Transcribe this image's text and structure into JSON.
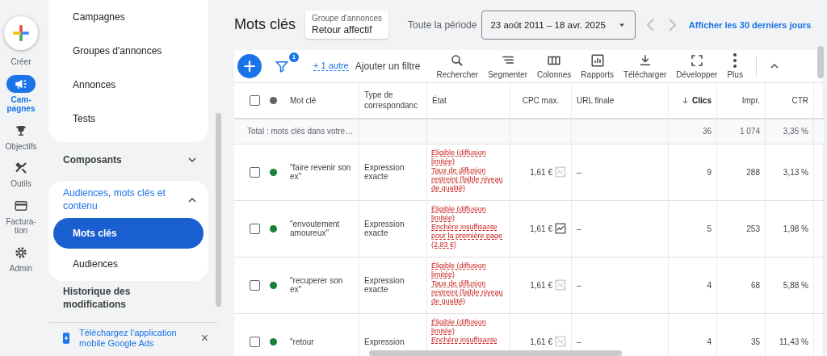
{
  "rail": [
    {
      "kind": "create",
      "label": "Créer",
      "selected": false
    },
    {
      "kind": "campaign",
      "label": "Cam-\npagnes",
      "selected": true
    },
    {
      "kind": "goals",
      "label": "Objectifs",
      "selected": false
    },
    {
      "kind": "tools",
      "label": "Outils",
      "selected": false
    },
    {
      "kind": "billing",
      "label": "Factura-\ntion",
      "selected": false
    },
    {
      "kind": "admin",
      "label": "Admin",
      "selected": false
    }
  ],
  "nav": [
    {
      "kind": "group",
      "items": [
        {
          "label": "Campagnes",
          "selected": false
        },
        {
          "label": "Groupes d'annonces",
          "selected": false
        },
        {
          "label": "Annonces",
          "selected": false
        },
        {
          "label": "Tests",
          "selected": false
        }
      ]
    },
    {
      "kind": "section",
      "label": "Composants",
      "expanded": false
    },
    {
      "kind": "section",
      "label": "Audiences, mots clés et contenu",
      "expanded": true,
      "children": [
        {
          "label": "Mots clés",
          "selected": true
        },
        {
          "label": "Audiences",
          "selected": false
        }
      ]
    },
    {
      "kind": "link",
      "label": "Historique des modifications"
    }
  ],
  "promo": {
    "text": "Téléchargez l'application mobile Google Ads",
    "close": "×"
  },
  "header": {
    "title": "Mots clés",
    "context_label": "Groupe d'annonces",
    "context_value": "Retour affectif",
    "period_label": "Toute la période",
    "date_range": "23 août 2011 – 18 avr. 2025",
    "recent_link": "Afficher les 30 derniers jours"
  },
  "toolbar": {
    "filter_count": "1",
    "more_filters": "+ 1 autre",
    "add_filter": "Ajouter un filtre",
    "tools": [
      {
        "kind": "search",
        "label": "Rechercher"
      },
      {
        "kind": "segment",
        "label": "Segmenter"
      },
      {
        "kind": "columns",
        "label": "Colonnes"
      },
      {
        "kind": "reports",
        "label": "Rapports"
      },
      {
        "kind": "download",
        "label": "Télécharger"
      },
      {
        "kind": "expand",
        "label": "Développer"
      },
      {
        "kind": "more",
        "label": "Plus"
      }
    ]
  },
  "table": {
    "select_all": {
      "checked": false
    },
    "columns": [
      {
        "label": "Mot clé",
        "sorted": false
      },
      {
        "label": "Type de correspondanc",
        "sorted": false
      },
      {
        "label": "État",
        "sorted": false
      },
      {
        "label": "CPC max.",
        "sorted": false
      },
      {
        "label": "URL finale",
        "sorted": false
      },
      {
        "label": "Clics",
        "sorted": true
      },
      {
        "label": "Impr.",
        "sorted": false
      },
      {
        "label": "CTR",
        "sorted": false
      }
    ],
    "total": {
      "label": "Total : mots clés dans votre…",
      "clicks": "36",
      "impressions": "1 074",
      "ctr": "3,35 %"
    },
    "rows": [
      {
        "checked": false,
        "color": "#188038",
        "keyword": "\"faire revenir son ex\"",
        "match": "Expression exacte",
        "status": [
          "Éligible (diffusion limitée)",
          "Taux de diffusion restreint (faible niveau de qualité)"
        ],
        "cpc": "1,61 €",
        "has_trend": false,
        "url": "–",
        "clicks": "9",
        "impressions": "288",
        "ctr": "3,13 %"
      },
      {
        "checked": false,
        "color": "#188038",
        "keyword": "\"envoutement amoureux\"",
        "match": "Expression exacte",
        "status": [
          "Éligible (diffusion limitée)",
          "Enchère insuffisante pour la première page (2,83 €)"
        ],
        "cpc": "1,61 €",
        "has_trend": true,
        "url": "–",
        "clicks": "5",
        "impressions": "253",
        "ctr": "1,98 %"
      },
      {
        "checked": false,
        "color": "#188038",
        "keyword": "\"recuperer son ex\"",
        "match": "Expression exacte",
        "status": [
          "Éligible (diffusion limitée)",
          "Taux de diffusion restreint (faible niveau de qualité)"
        ],
        "cpc": "1,61 €",
        "has_trend": false,
        "url": "–",
        "clicks": "4",
        "impressions": "68",
        "ctr": "5,88 %"
      },
      {
        "checked": false,
        "color": "#188038",
        "keyword": "\"retour",
        "match": "Expression",
        "status": [
          "Éligible (diffusion limitée)",
          "Enchère insuffisante"
        ],
        "cpc": "1,61 €",
        "has_trend": false,
        "url": "–",
        "clicks": "4",
        "impressions": "35",
        "ctr": "11,43 %"
      }
    ]
  }
}
